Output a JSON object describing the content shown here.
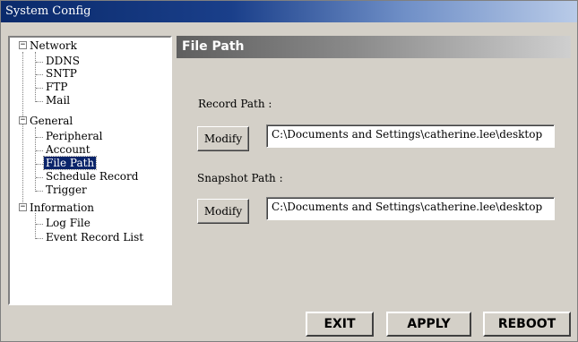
{
  "window": {
    "title": "System Config"
  },
  "tree": {
    "network": {
      "label": "Network",
      "children": [
        "DDNS",
        "SNTP",
        "FTP",
        "Mail"
      ]
    },
    "general": {
      "label": "General",
      "children": [
        "Peripheral",
        "Account",
        "File Path",
        "Schedule Record",
        "Trigger"
      ]
    },
    "information": {
      "label": "Information",
      "children": [
        "Log File",
        "Event Record List"
      ]
    },
    "selected": "File Path",
    "expander_symbol": "−"
  },
  "panel": {
    "title": "File Path",
    "record": {
      "label": "Record Path :",
      "button": "Modify",
      "value": "C:\\Documents and Settings\\catherine.lee\\desktop"
    },
    "snapshot": {
      "label": "Snapshot Path :",
      "button": "Modify",
      "value": "C:\\Documents and Settings\\catherine.lee\\desktop"
    }
  },
  "footer": {
    "exit": "EXIT",
    "apply": "APPLY",
    "reboot": "REBOOT"
  }
}
